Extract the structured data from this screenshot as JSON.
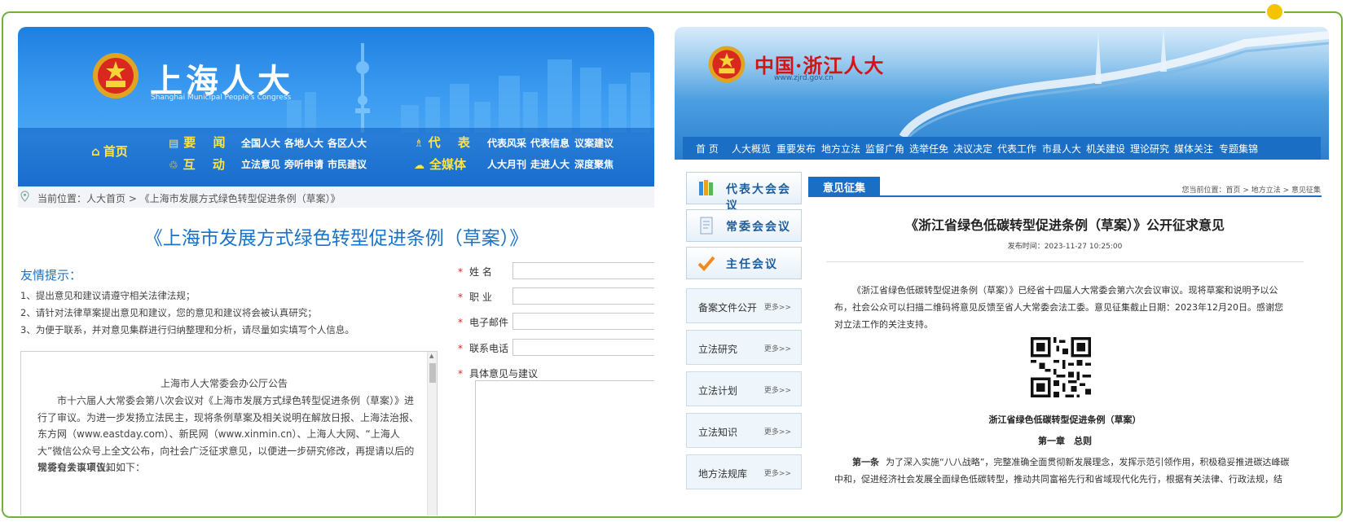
{
  "colors": {
    "frame": "#6fb23f",
    "accent_dot": "#f5c400",
    "sh_blue": "#1a73c9",
    "sh_nav_yellow": "#ffe24a",
    "zj_nav_blue": "#1a6ec4",
    "zj_title_red": "#d01515"
  },
  "shanghai": {
    "site_title": "上海人大",
    "site_subtitle": "Shanghai Municipal People's Congress",
    "nav": {
      "home": "首页",
      "cats": [
        "要 闻",
        "互 动",
        "代 表",
        "全媒体"
      ],
      "links_row1_a": [
        "全国人大",
        "各地人大",
        "各区人大"
      ],
      "links_row2_a": [
        "立法意见",
        "旁听申请",
        "市民建议"
      ],
      "links_row1_b": [
        "代表风采",
        "代表信息",
        "议案建议"
      ],
      "links_row2_b": [
        "人大月刊",
        "走进人大",
        "深度聚焦"
      ]
    },
    "breadcrumb": "当前位置：人大首页 > 《上海市发展方式绿色转型促进条例（草案）》",
    "page_title": "《上海市发展方式绿色转型促进条例（草案）》",
    "tip_title": "友情提示：",
    "tips": [
      "1、提出意见和建议请遵守相关法律法规；",
      "2、请针对法律草案提出意见和建议，您的意见和建议将会被认真研究；",
      "3、为便于联系，并对意见集群进行归纳整理和分析，请尽量如实填写个人信息。"
    ],
    "notice": {
      "title": "上海市人大常委会办公厅公告",
      "body": "市十六届人大常委会第八次会议对《上海市发展方式绿色转型促进条例（草案）》进行了审议。为进一步发扬立法民主，现将条例草案及相关说明在解放日报、上海法治报、东方网（www.eastday.com）、新民网（www.xinmin.cn）、上海人大网、“上海人大”微信公众号上全文公布，向社会广泛征求意见，以便进一步研究修改，再提请以后的常委会会议审议。",
      "last": "现将有关事项告知如下："
    },
    "form": {
      "required_mark": "*",
      "fields": [
        "姓 名",
        "职 业",
        "电子邮件",
        "联系电话",
        "具体意见与建议"
      ]
    }
  },
  "zhejiang": {
    "site_title": "中国·浙江人大",
    "site_url": "www.zjrd.gov.cn",
    "nav": [
      "首 页",
      "人大概览",
      "重要发布",
      "地方立法",
      "监督广角",
      "选举任免",
      "决议决定",
      "代表工作",
      "市县人大",
      "机关建设",
      "理论研究",
      "媒体关注",
      "专题集锦"
    ],
    "side_buttons": [
      "代表大会会议",
      "常委会会议",
      "主任会议"
    ],
    "side_boxes": [
      "备案文件公开",
      "立法研究",
      "立法计划",
      "立法知识",
      "地方法规库"
    ],
    "more_label": "更多>>",
    "tab": "意见征集",
    "breadcrumb": "您当前位置：首页 > 地方立法 > 意见征集",
    "title": "《浙江省绿色低碳转型促进条例（草案）》公开征求意见",
    "date": "发布时间：2023-11-27 10:25:00",
    "intro": "《浙江省绿色低碳转型促进条例（草案）》已经省十四届人大常委会第六次会议审议。现将草案和说明予以公布，社会公众可以扫描二维码将意见反馈至省人大常委会法工委。意见征集截止日期：2023年12月20日。感谢您对立法工作的关注支持。",
    "doc_title": "浙江省绿色低碳转型促进条例（草案）",
    "chapter": "第一章　总则",
    "article_no": "第一条",
    "article_text": "为了深入实施“八八战略”，完整准确全面贯彻新发展理念，发挥示范引领作用，积极稳妥推进碳达峰碳中和，促进经济社会发展全面绿色低碳转型，推动共同富裕先行和省域现代化先行，根据有关法律、行政法规，结"
  }
}
